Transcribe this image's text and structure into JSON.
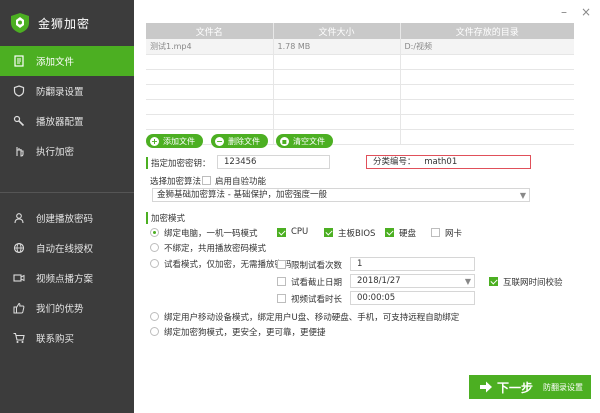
{
  "app": {
    "name": "金狮加密"
  },
  "sidebar": {
    "items": [
      {
        "label": "添加文件",
        "icon": "document-icon"
      },
      {
        "label": "防翻录设置",
        "icon": "shield-icon"
      },
      {
        "label": "播放器配置",
        "icon": "wrench-icon"
      },
      {
        "label": "执行加密",
        "icon": "hand-icon"
      }
    ],
    "items2": [
      {
        "label": "创建播放密码",
        "icon": "person-icon"
      },
      {
        "label": "自动在线授权",
        "icon": "globe-icon"
      },
      {
        "label": "视频点播方案",
        "icon": "video-icon"
      },
      {
        "label": "我们的优势",
        "icon": "thumbs-up-icon"
      },
      {
        "label": "联系购买",
        "icon": "cart-icon"
      }
    ]
  },
  "file_table": {
    "headers": [
      "文件名",
      "文件大小",
      "文件存放的目录"
    ],
    "rows": [
      [
        "测试1.mp4",
        "1.78 MB",
        "D:/视频"
      ]
    ]
  },
  "buttons": {
    "add_file": "添加文件",
    "delete_file": "删除文件",
    "clear_file": "清空文件"
  },
  "form": {
    "encrypt_key_label": "指定加密密钥：",
    "encrypt_key_value": "123456",
    "category_label": "分类编号：",
    "category_value": "math01",
    "algorithm_label": "选择加密算法",
    "auto_verify_label": "启用自验功能",
    "algorithm_value": "金狮基础加密算法 - 基础保护，加密强度一般",
    "mode_title": "加密模式",
    "mode_bind_computer": "绑定电脑，一机一码模式",
    "hw_cpu": "CPU",
    "hw_bios": "主板BIOS",
    "hw_disk": "硬盘",
    "hw_nic": "网卡",
    "mode_no_bind": "不绑定，共用播放密码模式",
    "mode_trial": "试看模式，仅加密，无需播放密码",
    "limit_trial_count_label": "限制试看次数",
    "limit_trial_count_value": "1",
    "trial_deadline_label": "试看截止日期",
    "trial_deadline_value": "2018/1/27",
    "internet_time_label": "互联网时间校验",
    "trial_duration_label": "视频试看时长",
    "trial_duration_value": "00:00:05",
    "mode_mobile": "绑定用户移动设备模式，绑定用户U盘、移动硬盘、手机，可支持远程自助绑定",
    "mode_dongle": "绑定加密狗模式，更安全，更可靠，更便捷"
  },
  "footer": {
    "next_label": "下一步",
    "next_sub": "防翻录设置"
  },
  "colors": {
    "accent": "#4caf22",
    "sidebar_bg": "#3c3c3c",
    "alert_border": "#e0505a"
  }
}
